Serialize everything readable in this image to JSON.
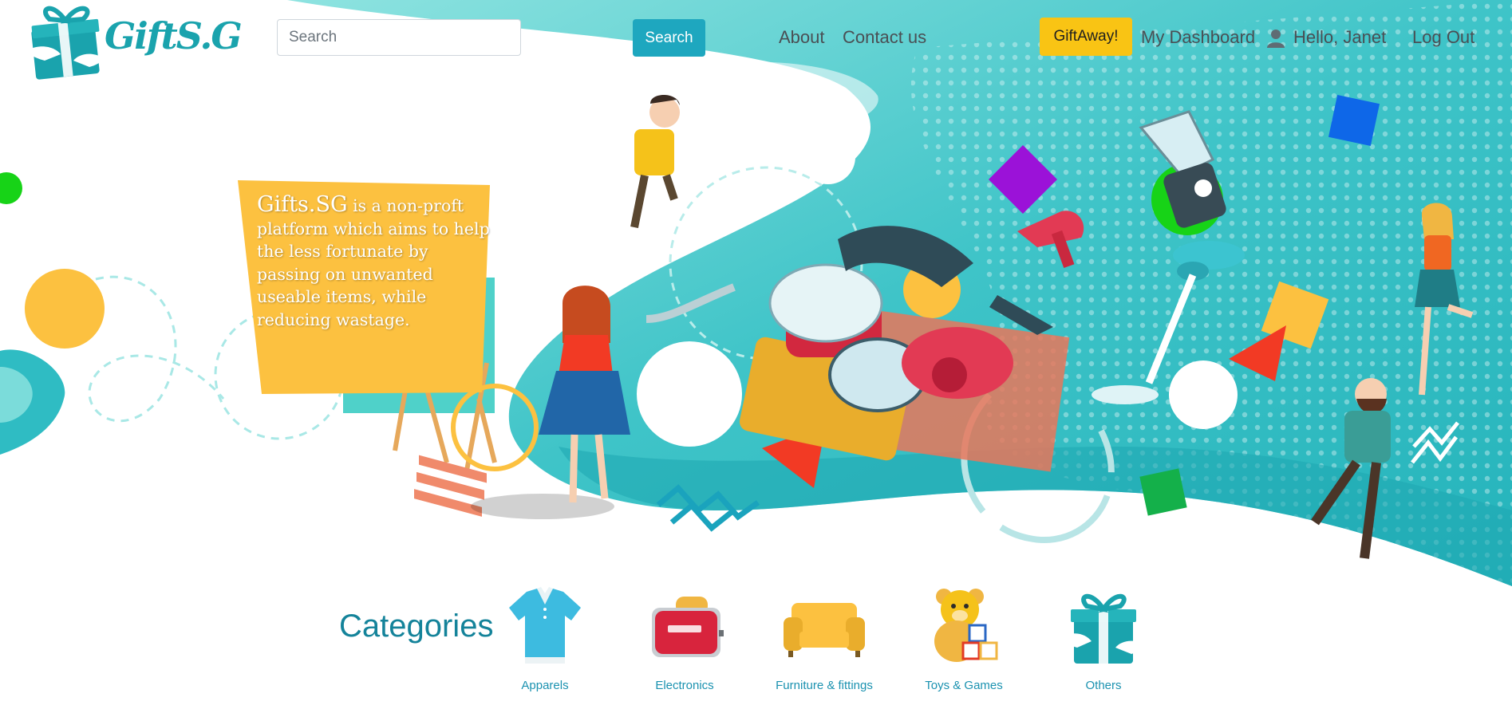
{
  "header": {
    "logo_text": "GiftS.G",
    "search": {
      "placeholder": "Search",
      "button_label": "Search"
    },
    "nav": {
      "about": "About",
      "contact": "Contact us"
    },
    "giftaway_label": "GiftAway!",
    "dashboard_label": "My Dashboard",
    "greeting": "Hello, Janet",
    "logout_label": "Log Out"
  },
  "hero": {
    "brand": "Gifts.SG",
    "tagline": " is a non-proft platform which aims to help the less fortunate by passing on unwanted useable items, while reducing wastage."
  },
  "categories": {
    "title": "Categories",
    "items": [
      {
        "label": "Apparels",
        "icon": "shirt-icon"
      },
      {
        "label": "Electronics",
        "icon": "toaster-icon"
      },
      {
        "label": "Furniture & fittings",
        "icon": "sofa-icon"
      },
      {
        "label": "Toys & Games",
        "icon": "teddy-bear-icon"
      },
      {
        "label": "Others",
        "icon": "gift-box-icon"
      }
    ]
  },
  "colors": {
    "teal": "#2fbcc3",
    "yellow": "#fcc140",
    "search_button": "#1ea7bf",
    "giftaway_button": "#f9c414",
    "category_text": "#14839a"
  }
}
